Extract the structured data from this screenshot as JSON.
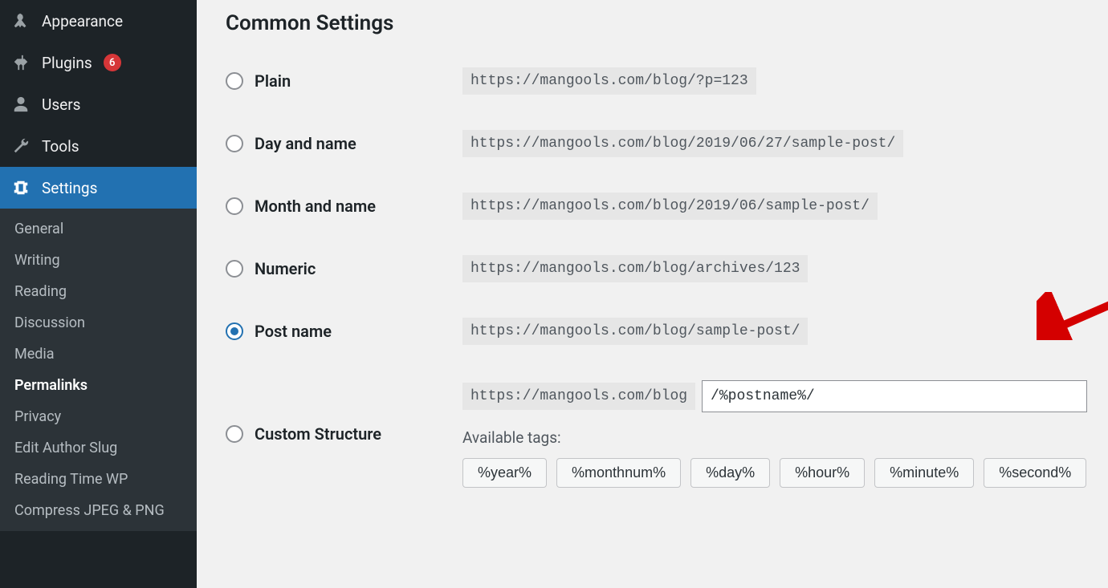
{
  "sidebar": {
    "items": [
      {
        "icon": "appearance",
        "label": "Appearance"
      },
      {
        "icon": "plugins",
        "label": "Plugins",
        "badge": "6"
      },
      {
        "icon": "users",
        "label": "Users"
      },
      {
        "icon": "tools",
        "label": "Tools"
      },
      {
        "icon": "settings",
        "label": "Settings",
        "active": true
      }
    ],
    "sub": [
      {
        "label": "General"
      },
      {
        "label": "Writing"
      },
      {
        "label": "Reading"
      },
      {
        "label": "Discussion"
      },
      {
        "label": "Media"
      },
      {
        "label": "Permalinks",
        "current": true
      },
      {
        "label": "Privacy"
      },
      {
        "label": "Edit Author Slug"
      },
      {
        "label": "Reading Time WP"
      },
      {
        "label": "Compress JPEG & PNG"
      }
    ]
  },
  "page": {
    "section_title": "Common Settings",
    "options": [
      {
        "key": "plain",
        "label": "Plain",
        "example": "https://mangools.com/blog/?p=123",
        "checked": false
      },
      {
        "key": "day-name",
        "label": "Day and name",
        "example": "https://mangools.com/blog/2019/06/27/sample-post/",
        "checked": false
      },
      {
        "key": "month-name",
        "label": "Month and name",
        "example": "https://mangools.com/blog/2019/06/sample-post/",
        "checked": false
      },
      {
        "key": "numeric",
        "label": "Numeric",
        "example": "https://mangools.com/blog/archives/123",
        "checked": false
      },
      {
        "key": "post-name",
        "label": "Post name",
        "example": "https://mangools.com/blog/sample-post/",
        "checked": true
      },
      {
        "key": "custom",
        "label": "Custom Structure",
        "checked": false
      }
    ],
    "custom": {
      "base": "https://mangools.com/blog",
      "value": "/%postname%/",
      "available_label": "Available tags:",
      "tags": [
        "%year%",
        "%monthnum%",
        "%day%",
        "%hour%",
        "%minute%",
        "%second%"
      ]
    }
  },
  "colors": {
    "accent": "#2271b1",
    "badge": "#d63638",
    "arrow": "#d40000"
  }
}
